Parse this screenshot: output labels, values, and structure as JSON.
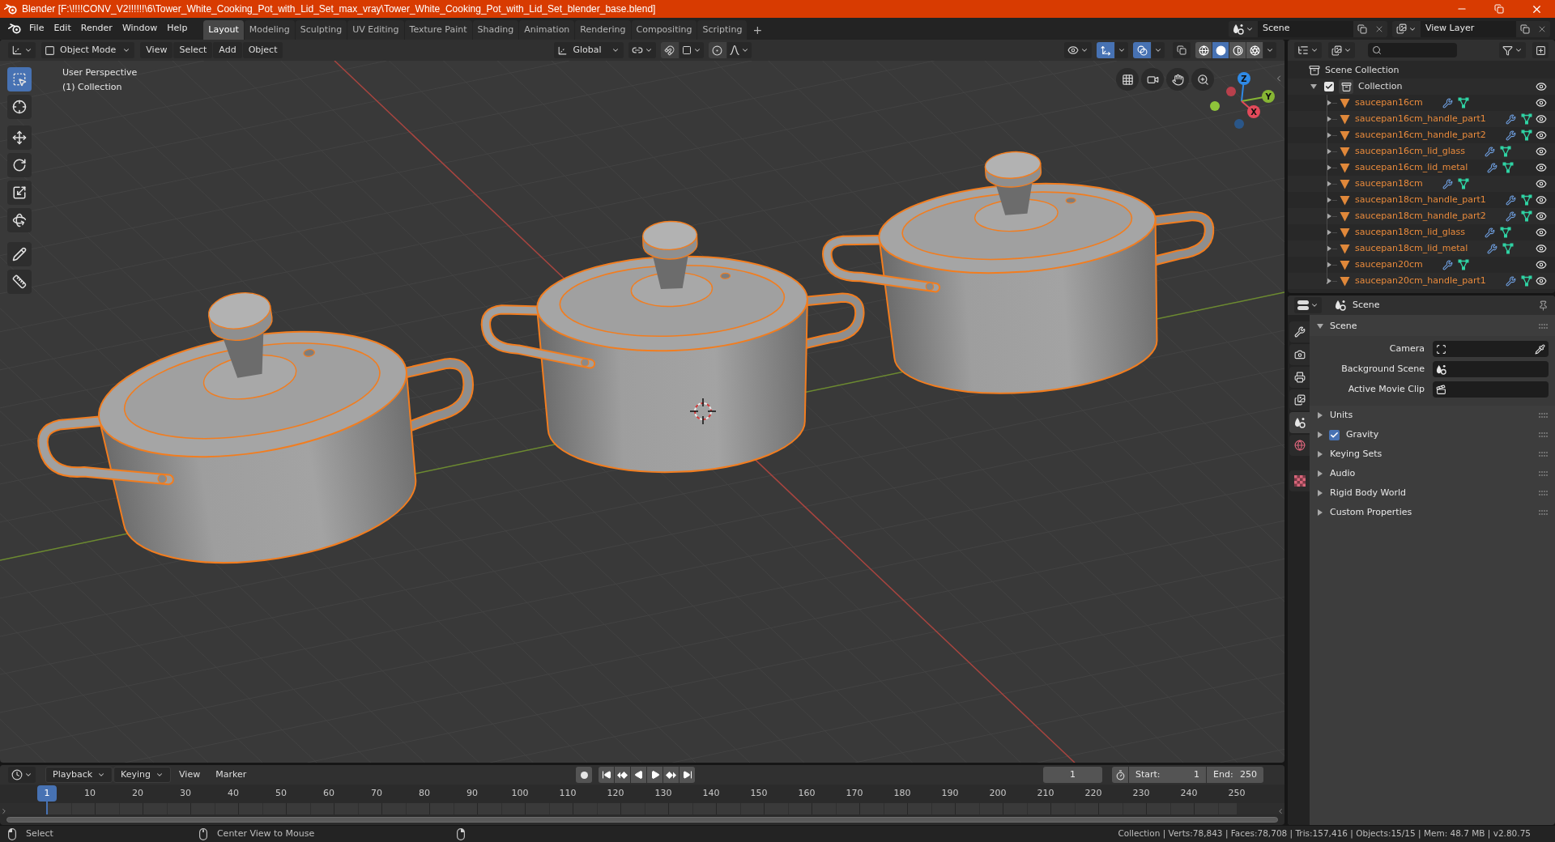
{
  "window": {
    "title": "Blender [F:\\!!!!CONV_V2!!!!!!\\6\\Tower_White_Cooking_Pot_with_Lid_Set_max_vray\\Tower_White_Cooking_Pot_with_Lid_Set_blender_base.blend]"
  },
  "top_bar": {
    "menus": [
      "File",
      "Edit",
      "Render",
      "Window",
      "Help"
    ],
    "workspaces": [
      {
        "label": "Layout",
        "selected": true
      },
      {
        "label": "Modeling",
        "selected": false
      },
      {
        "label": "Sculpting",
        "selected": false
      },
      {
        "label": "UV Editing",
        "selected": false
      },
      {
        "label": "Texture Paint",
        "selected": false
      },
      {
        "label": "Shading",
        "selected": false
      },
      {
        "label": "Animation",
        "selected": false
      },
      {
        "label": "Rendering",
        "selected": false
      },
      {
        "label": "Compositing",
        "selected": false
      },
      {
        "label": "Scripting",
        "selected": false
      }
    ],
    "add_workspace": "+",
    "scene": "Scene",
    "view_layer": "View Layer"
  },
  "viewport": {
    "mode": "Object Mode",
    "menus": [
      "View",
      "Select",
      "Add",
      "Object"
    ],
    "orientation": "Global",
    "toggles": {
      "gizmos": true,
      "overlays": true,
      "xray": false
    },
    "shading": [
      {
        "kind": "wireframe",
        "selected": false
      },
      {
        "kind": "solid",
        "selected": true
      },
      {
        "kind": "material",
        "selected": false
      },
      {
        "kind": "rendered",
        "selected": false
      }
    ],
    "info": [
      "User Perspective",
      "(1) Collection"
    ],
    "tools": [
      {
        "kind": "select",
        "selected": true
      },
      {
        "kind": "cursor",
        "selected": false
      },
      {
        "kind": "move",
        "selected": false
      },
      {
        "kind": "rotate",
        "selected": false
      },
      {
        "kind": "scale",
        "selected": false
      },
      {
        "kind": "transform",
        "selected": false
      },
      {
        "kind": "annotate",
        "selected": false
      },
      {
        "kind": "measure",
        "selected": false
      }
    ],
    "gizmo_axes": [
      {
        "label": "Z",
        "color": "#2f8ae6"
      },
      {
        "label": "Y",
        "color": "#86b534"
      },
      {
        "label": "X",
        "color": "#e34a5a"
      }
    ]
  },
  "outliner": {
    "tree": {
      "name": "Scene Collection",
      "children": [
        {
          "name": "Collection",
          "expanded": true,
          "checked": true,
          "visible": true,
          "children": [
            {
              "name": "saucepan16cm",
              "selected": true,
              "expanded": false,
              "visible": true
            },
            {
              "name": "saucepan16cm_handle_part1",
              "selected": true,
              "expanded": false,
              "visible": true
            },
            {
              "name": "saucepan16cm_handle_part2",
              "selected": true,
              "expanded": false,
              "visible": true
            },
            {
              "name": "saucepan16cm_lid_glass",
              "selected": true,
              "expanded": false,
              "visible": true
            },
            {
              "name": "saucepan16cm_lid_metal",
              "selected": true,
              "expanded": false,
              "visible": true
            },
            {
              "name": "saucepan18cm",
              "selected": true,
              "expanded": false,
              "visible": true
            },
            {
              "name": "saucepan18cm_handle_part1",
              "selected": true,
              "expanded": false,
              "visible": true
            },
            {
              "name": "saucepan18cm_handle_part2",
              "selected": true,
              "expanded": false,
              "visible": true
            },
            {
              "name": "saucepan18cm_lid_glass",
              "selected": true,
              "expanded": false,
              "visible": true
            },
            {
              "name": "saucepan18cm_lid_metal",
              "selected": true,
              "expanded": false,
              "visible": true
            },
            {
              "name": "saucepan20cm",
              "selected": true,
              "expanded": false,
              "visible": true
            },
            {
              "name": "saucepan20cm_handle_part1",
              "selected": true,
              "expanded": false,
              "visible": true
            }
          ]
        }
      ]
    }
  },
  "properties": {
    "context": "Scene",
    "tabs": [
      {
        "kind": "tool",
        "selected": false
      },
      {
        "kind": "render",
        "selected": false
      },
      {
        "kind": "output",
        "selected": false
      },
      {
        "kind": "view_layer",
        "selected": false
      },
      {
        "kind": "scene",
        "selected": true
      },
      {
        "kind": "world",
        "selected": false
      },
      {
        "kind": "texture",
        "selected": false
      }
    ],
    "panels": [
      {
        "kind": "plain",
        "label": "Scene",
        "expanded": true,
        "fields": [
          {
            "kind": "camera",
            "label": "Camera"
          },
          {
            "kind": "scene",
            "label": "Background Scene"
          },
          {
            "kind": "clip",
            "label": "Active Movie Clip"
          }
        ]
      },
      {
        "kind": "plain",
        "label": "Units",
        "expanded": false
      },
      {
        "kind": "checkbox",
        "label": "Gravity",
        "expanded": false,
        "checked": true
      },
      {
        "kind": "plain",
        "label": "Keying Sets",
        "expanded": false
      },
      {
        "kind": "plain",
        "label": "Audio",
        "expanded": false
      },
      {
        "kind": "plain",
        "label": "Rigid Body World",
        "expanded": false
      },
      {
        "kind": "plain",
        "label": "Custom Properties",
        "expanded": false
      }
    ]
  },
  "timeline": {
    "menus": [
      {
        "kind": "dropdown",
        "label": "Playback"
      },
      {
        "kind": "dropdown",
        "label": "Keying"
      },
      {
        "kind": "menu",
        "label": "View"
      },
      {
        "kind": "menu",
        "label": "Marker"
      }
    ],
    "frame": "1",
    "start": {
      "label": "Start:",
      "value": "1"
    },
    "end": {
      "label": "End:",
      "value": "250"
    },
    "playhead": "1",
    "ruler": [
      "10",
      "20",
      "30",
      "40",
      "50",
      "60",
      "70",
      "80",
      "90",
      "100",
      "110",
      "120",
      "130",
      "140",
      "150",
      "160",
      "170",
      "180",
      "190",
      "200",
      "210",
      "220",
      "230",
      "240",
      "250"
    ]
  },
  "status_bar": {
    "hints": [
      {
        "kind": "left",
        "label": "Select"
      },
      {
        "kind": "middle",
        "label": "Center View to Mouse"
      },
      {
        "kind": "right"
      }
    ],
    "stats": "Collection | Verts:78,843 | Faces:78,708 | Tris:157,416 | Objects:15/15 | Mem: 48.7 MB | v2.80.75"
  }
}
